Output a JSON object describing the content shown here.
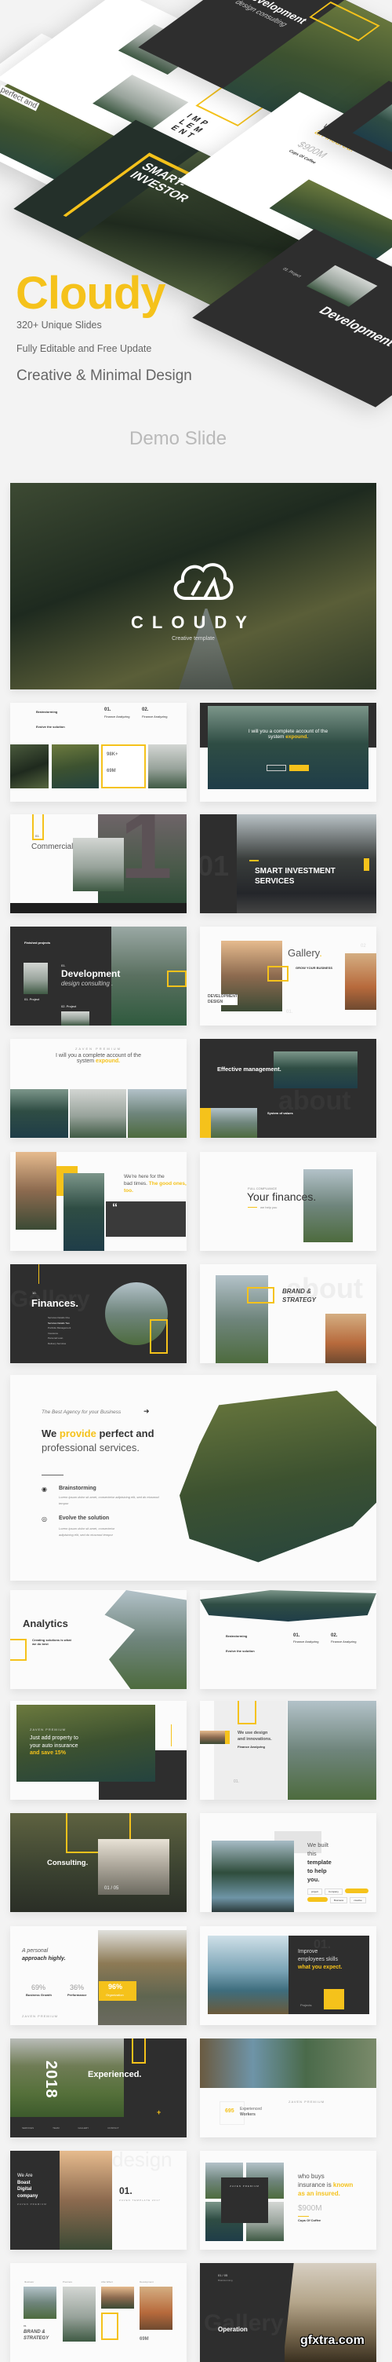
{
  "colors": {
    "accent": "#f5c21b",
    "dark": "#2e2e2e",
    "background": "#f3f3f3"
  },
  "mockups": {
    "smart_investor": "SMART-INVESTOR",
    "development": "Development",
    "design_consulting": "design consulting",
    "implement": "IMP LEM ENT",
    "insurance_1": "who buys insurance is ",
    "insurance_known": "known as an insured.",
    "insurance_value": "$900M",
    "insurance_sub": "Cups Of Coffee",
    "project": "01. Project",
    "perfect": "perfect and"
  },
  "header": {
    "title": "Cloudy",
    "features": [
      "320+ Unique Slides",
      "Fully Editable and Free Update",
      "Creative & Minimal Design"
    ],
    "demo_label": "Demo Slide"
  },
  "hero": {
    "brand": "CLOUDY",
    "tagline": "Creative template",
    "icon": "cloud-logo-icon"
  },
  "s1": {
    "items": [
      "Brainstorming",
      "Evolve the solution"
    ],
    "col1_num": "01.",
    "col1_title": "Finance Analyzing",
    "col2_num": "02.",
    "col2_title": "Finance Analyzing",
    "stat1": "98K+",
    "stat2": "69M"
  },
  "s2": {
    "line1": "I will you a complete account of the",
    "line2": "system ",
    "highlight": "expound."
  },
  "s3": {
    "num": "01.",
    "title": "Commercial",
    "big": "1"
  },
  "s4": {
    "bg_num": "01",
    "title_1": "SMART INVESTMENT",
    "title_2": "SERVICES"
  },
  "s5": {
    "label": "Finished projects",
    "num": "01.",
    "title": "Development",
    "subtitle": "design consulting .",
    "p1": "01. Project",
    "p2": "02. Project"
  },
  "s6": {
    "title": "Gallery",
    "dot": ".",
    "sub": "GROW YOUR BUSINESS",
    "tag_1": "DEVELOPMENT",
    "tag_2": "DESIGN",
    "n1": "01.",
    "n2": "02"
  },
  "s7": {
    "kicker": "ZAVEN PREMIUM",
    "line1": "I will you a complete account of the",
    "line2": "system ",
    "highlight": "expound."
  },
  "s8": {
    "title": "Effective management.",
    "sub": "System of values",
    "bg_word": "about"
  },
  "s9": {
    "line1": "We're here for the",
    "line2": "bad times. ",
    "highlight": "The good ones, too.",
    "quote": "“"
  },
  "s10": {
    "kicker": "FULL COMPLIANCE",
    "title": "Your finances.",
    "sub": "we help you",
    "bg_word": "about"
  },
  "s11": {
    "num": "10.",
    "title": "Finances.",
    "bg_word": "Gallery",
    "menu": [
      "Services Details One",
      "Services Details Two",
      "Portfolio Management",
      "Insurance",
      "Personal Loan",
      "Delivery Services"
    ]
  },
  "s12": {
    "title_1": "BRAND &",
    "title_2": "STRATEGY",
    "bg_word": "about"
  },
  "wide": {
    "kicker": "The Best Agency for your Business",
    "h_1": "We ",
    "h_hl": "provide",
    "h_2": " perfect and",
    "h_3": "professional services.",
    "items": [
      {
        "title": "Brainstorming",
        "text": "Lorem ipsum dolor sit amet, consectetur adipisicing elit, sed do eiusmod tempor"
      },
      {
        "title": "Evolve the solution",
        "text": "Lorem ipsum dolor sit amet, consectetur adipisicing elit, sed do eiusmod tempor"
      }
    ]
  },
  "s13": {
    "title": "Analytics",
    "sub": "Creating solutions is what we do best"
  },
  "s14": {
    "items": [
      "Brainstorming",
      "Evolve the solution"
    ],
    "col1_num": "01.",
    "col1_title": "Finance Analyzing",
    "col2_num": "02.",
    "col2_title": "Finance Analyzing"
  },
  "s15": {
    "kicker": "ZAVEN PREMIUM",
    "line1": "Just add property to",
    "line2": "your auto insurance",
    "highlight": "and save 15%"
  },
  "s16": {
    "title_1": "We use design",
    "title_2": "and innovations.",
    "sub": "Finance Analyzing",
    "num": "01."
  },
  "s17": {
    "title": "Consulting.",
    "pager": "01 / 05"
  },
  "s18": {
    "l1": "We built",
    "l2": "this",
    "l3": "template",
    "l4": "to help",
    "l5": "you.",
    "tags": [
      "project",
      "Company",
      "Business",
      "creative"
    ]
  },
  "s19": {
    "l1": "A personal",
    "l2": "approach highly.",
    "stats": [
      {
        "value": "69%",
        "label": "Business Growth"
      },
      {
        "value": "36%",
        "label": "Performance"
      },
      {
        "value": "96%",
        "label": "Organization"
      }
    ],
    "footer": "ZAVEN PREMIUM"
  },
  "s20": {
    "bg_num": "01.",
    "l1": "Improve",
    "l2": "employees skills",
    "highlight": "what you expect.",
    "button": "Projects"
  },
  "s21": {
    "year": "2018",
    "title": "Experienced.",
    "nav": [
      "SERVICES",
      "TEAM",
      "GALLERY",
      "CONTACT"
    ]
  },
  "s22": {
    "value": "695",
    "l1": "Experienced",
    "l2": "Workers",
    "kicker": "ZAVEN PREMIUM"
  },
  "s23": {
    "l1": "We Are",
    "l2": "Boast",
    "l3": "Digital",
    "l4": "company",
    "kicker": "ZAVEN PREMIUM",
    "num": "01.",
    "sub": "ZAVEN TEMPLATE 2017",
    "bg_word": "design"
  },
  "s24": {
    "box_title": "ZAVEN PREMIUM",
    "l1": "who buys",
    "l2": "insurance is ",
    "hl1": "known",
    "hl2": "as an insured.",
    "value": "$900M",
    "sub": "Cups Of Coffee"
  },
  "s25": {
    "labels": [
      "Illustrator",
      "Premiere",
      "After Effect",
      "Development"
    ],
    "num": "01.",
    "title_1": "BRAND &",
    "title_2": "STRATEGY",
    "value": "69M"
  },
  "s26": {
    "pager": "01 / 05",
    "sub": "Brainstorming",
    "title": "Operation",
    "bg_word": "Gallery"
  },
  "watermark": "gfxtra.com"
}
